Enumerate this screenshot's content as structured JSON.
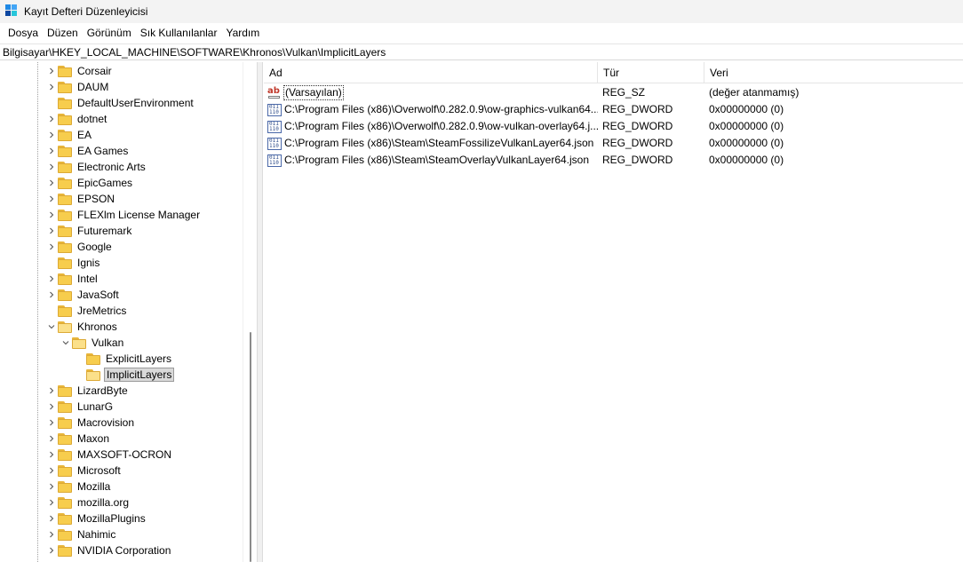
{
  "window": {
    "title": "Kayıt Defteri Düzenleyicisi",
    "icon": "registry-editor-icon"
  },
  "menu": [
    "Dosya",
    "Düzen",
    "Görünüm",
    "Sık Kullanılanlar",
    "Yardım"
  ],
  "address": "Bilgisayar\\HKEY_LOCAL_MACHINE\\SOFTWARE\\Khronos\\Vulkan\\ImplicitLayers",
  "tree": [
    {
      "label": "Corsair",
      "level": 0,
      "expander": "collapsed"
    },
    {
      "label": "DAUM",
      "level": 0,
      "expander": "collapsed"
    },
    {
      "label": "DefaultUserEnvironment",
      "level": 0,
      "expander": "none"
    },
    {
      "label": "dotnet",
      "level": 0,
      "expander": "collapsed"
    },
    {
      "label": "EA",
      "level": 0,
      "expander": "collapsed"
    },
    {
      "label": "EA Games",
      "level": 0,
      "expander": "collapsed"
    },
    {
      "label": "Electronic Arts",
      "level": 0,
      "expander": "collapsed"
    },
    {
      "label": "EpicGames",
      "level": 0,
      "expander": "collapsed"
    },
    {
      "label": "EPSON",
      "level": 0,
      "expander": "collapsed"
    },
    {
      "label": "FLEXlm License Manager",
      "level": 0,
      "expander": "collapsed"
    },
    {
      "label": "Futuremark",
      "level": 0,
      "expander": "collapsed"
    },
    {
      "label": "Google",
      "level": 0,
      "expander": "collapsed"
    },
    {
      "label": "Ignis",
      "level": 0,
      "expander": "none"
    },
    {
      "label": "Intel",
      "level": 0,
      "expander": "collapsed"
    },
    {
      "label": "JavaSoft",
      "level": 0,
      "expander": "collapsed"
    },
    {
      "label": "JreMetrics",
      "level": 0,
      "expander": "none"
    },
    {
      "label": "Khronos",
      "level": 0,
      "expander": "expanded"
    },
    {
      "label": "Vulkan",
      "level": 1,
      "expander": "expanded"
    },
    {
      "label": "ExplicitLayers",
      "level": 2,
      "expander": "none"
    },
    {
      "label": "ImplicitLayers",
      "level": 2,
      "expander": "none",
      "selected": true
    },
    {
      "label": "LizardByte",
      "level": 0,
      "expander": "collapsed"
    },
    {
      "label": "LunarG",
      "level": 0,
      "expander": "collapsed"
    },
    {
      "label": "Macrovision",
      "level": 0,
      "expander": "collapsed"
    },
    {
      "label": "Maxon",
      "level": 0,
      "expander": "collapsed"
    },
    {
      "label": "MAXSOFT-OCRON",
      "level": 0,
      "expander": "collapsed"
    },
    {
      "label": "Microsoft",
      "level": 0,
      "expander": "collapsed"
    },
    {
      "label": "Mozilla",
      "level": 0,
      "expander": "collapsed"
    },
    {
      "label": "mozilla.org",
      "level": 0,
      "expander": "collapsed"
    },
    {
      "label": "MozillaPlugins",
      "level": 0,
      "expander": "collapsed"
    },
    {
      "label": "Nahimic",
      "level": 0,
      "expander": "collapsed"
    },
    {
      "label": "NVIDIA Corporation",
      "level": 0,
      "expander": "collapsed"
    }
  ],
  "list": {
    "columns": [
      "Ad",
      "Tür",
      "Veri"
    ],
    "rows": [
      {
        "icon": "string-value-icon",
        "name": "(Varsayılan)",
        "type": "REG_SZ",
        "data": "(değer atanmamış)",
        "focused": true
      },
      {
        "icon": "binary-value-icon",
        "name": "C:\\Program Files (x86)\\Overwolf\\0.282.0.9\\ow-graphics-vulkan64....",
        "type": "REG_DWORD",
        "data": "0x00000000 (0)"
      },
      {
        "icon": "binary-value-icon",
        "name": "C:\\Program Files (x86)\\Overwolf\\0.282.0.9\\ow-vulkan-overlay64.j...",
        "type": "REG_DWORD",
        "data": "0x00000000 (0)"
      },
      {
        "icon": "binary-value-icon",
        "name": "C:\\Program Files (x86)\\Steam\\SteamFossilizeVulkanLayer64.json",
        "type": "REG_DWORD",
        "data": "0x00000000 (0)"
      },
      {
        "icon": "binary-value-icon",
        "name": "C:\\Program Files (x86)\\Steam\\SteamOverlayVulkanLayer64.json",
        "type": "REG_DWORD",
        "data": "0x00000000 (0)"
      }
    ]
  },
  "colors": {
    "folder": "#f7cd4d",
    "folder_edge": "#dca935",
    "selection": "#d9d9d9",
    "string_icon": "#c0392b",
    "binary_icon": "#4a68a8"
  }
}
